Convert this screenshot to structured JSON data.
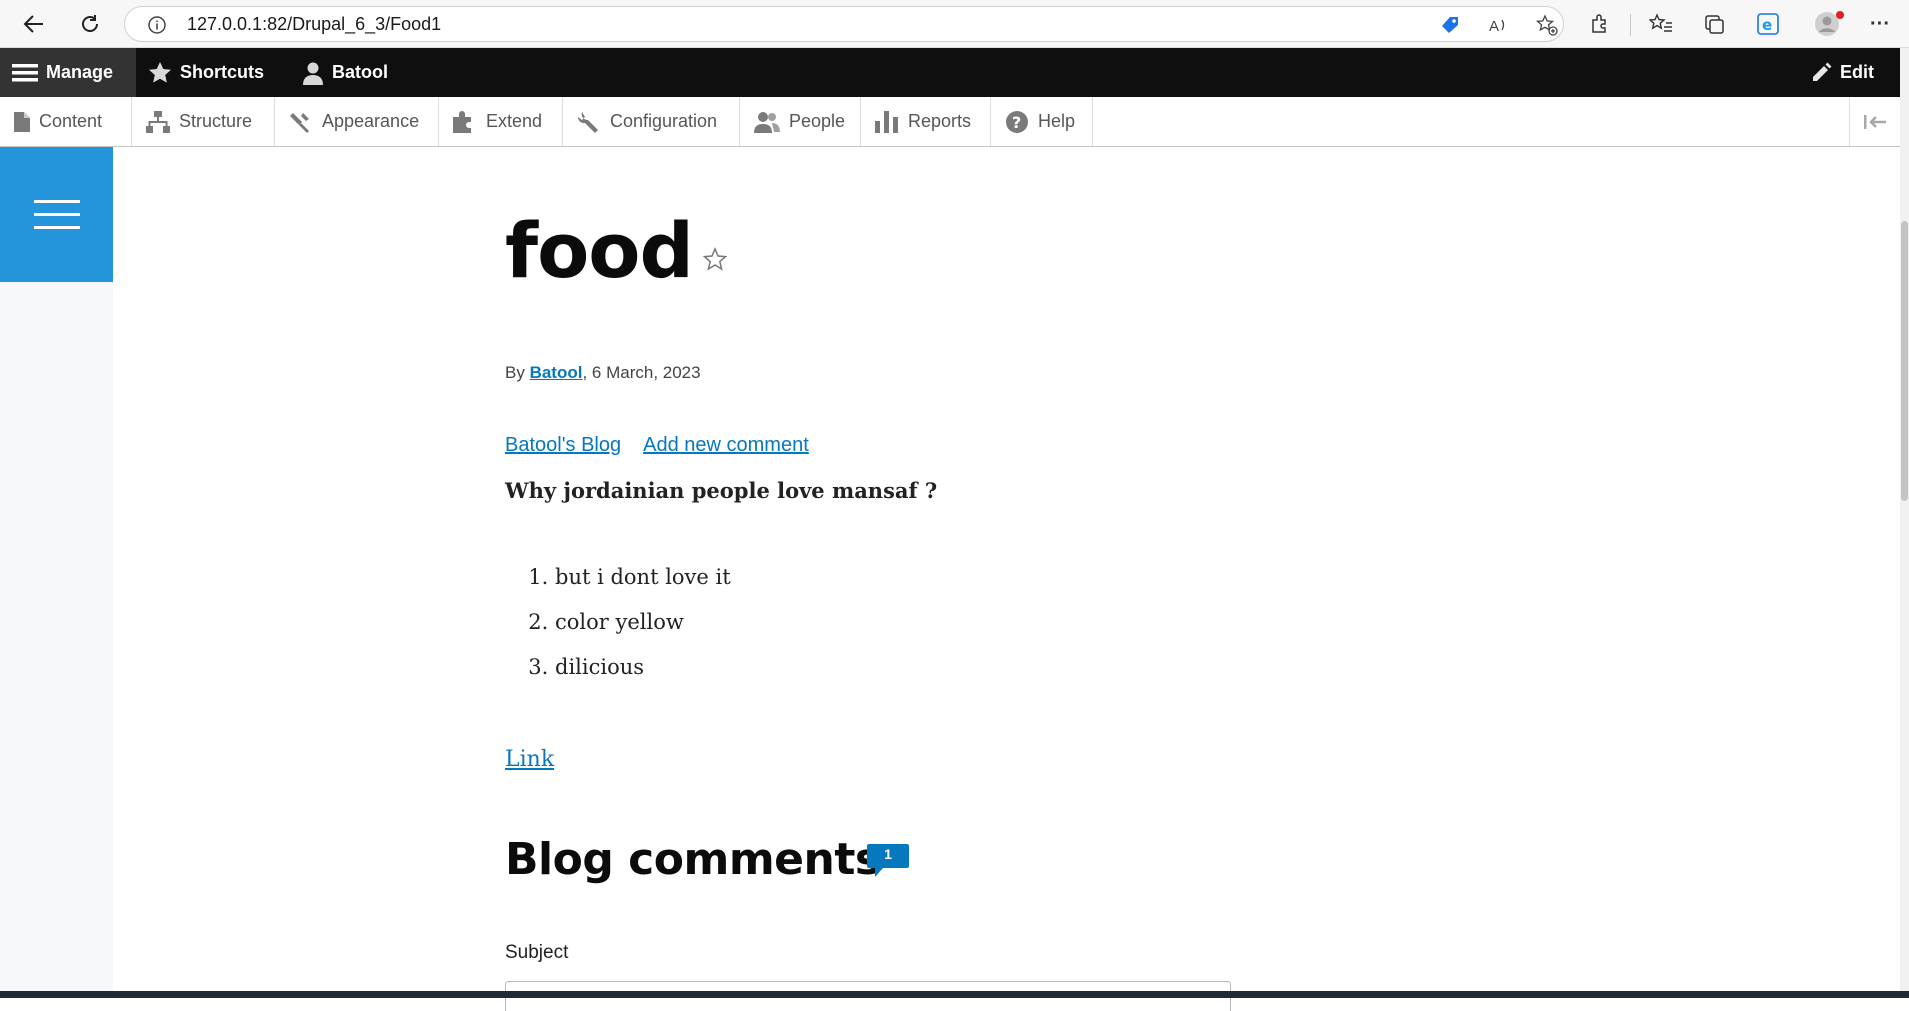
{
  "browser": {
    "url": "127.0.0.1:82/Drupal_6_3/Food1",
    "buttons": [
      "back-icon",
      "refresh-icon",
      "info-icon",
      "tag-icon",
      "read-aloud-icon",
      "favorite-add-icon",
      "extensions-icon",
      "favorites-icon",
      "collections-icon",
      "edge-icon",
      "profile-icon",
      "more-icon"
    ],
    "more_label": "···"
  },
  "admin_toolbar": {
    "manage_label": "Manage",
    "shortcuts_label": "Shortcuts",
    "user_label": "Batool",
    "edit_label": "Edit"
  },
  "tray": {
    "items": [
      {
        "label": "Content",
        "icon": "file-icon"
      },
      {
        "label": "Structure",
        "icon": "sitemap-icon"
      },
      {
        "label": "Appearance",
        "icon": "paint-icon"
      },
      {
        "label": "Extend",
        "icon": "puzzle-icon"
      },
      {
        "label": "Configuration",
        "icon": "wrench-icon"
      },
      {
        "label": "People",
        "icon": "people-icon"
      },
      {
        "label": "Reports",
        "icon": "bar-chart-icon"
      },
      {
        "label": "Help",
        "icon": "help-icon"
      }
    ]
  },
  "node": {
    "title": "food",
    "byline_prefix": "By",
    "author": "Batool",
    "date": ", 6 March, 2023",
    "links": [
      "Batool's Blog",
      "Add new comment"
    ],
    "question": "Why jordainian people love mansaf ?",
    "list": [
      "but i dont love it",
      "color yellow",
      "dilicious"
    ],
    "link_text": "Link"
  },
  "comments": {
    "heading": "Blog comments",
    "count": "1",
    "subject_label": "Subject"
  },
  "colors": {
    "accent": "#2494db",
    "link": "#0678be",
    "admin_bar": "#0f0f0f"
  }
}
